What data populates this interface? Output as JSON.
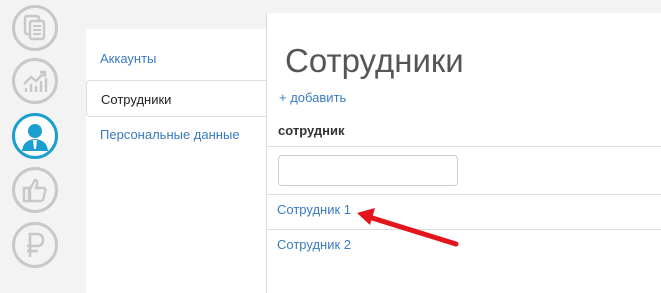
{
  "sidebar": {
    "icons": [
      {
        "name": "documents-icon",
        "active": false
      },
      {
        "name": "chart-icon",
        "active": false
      },
      {
        "name": "user-icon",
        "active": true
      },
      {
        "name": "thumbs-up-icon",
        "active": false
      },
      {
        "name": "ruble-icon",
        "active": false
      }
    ]
  },
  "subnav": {
    "items": [
      {
        "label": "Аккаунты",
        "active": false
      },
      {
        "label": "Сотрудники",
        "active": true
      },
      {
        "label": "Персональные данные",
        "active": false
      }
    ]
  },
  "main": {
    "title": "Сотрудники",
    "add_label": "+ добавить",
    "table": {
      "column_header": "сотрудник",
      "filter_value": "",
      "rows": [
        "Сотрудник 1",
        "Сотрудник 2"
      ]
    }
  },
  "colors": {
    "accent": "#1a9fd0",
    "link": "#3a7bbf",
    "annotation_arrow": "#e3141b"
  }
}
